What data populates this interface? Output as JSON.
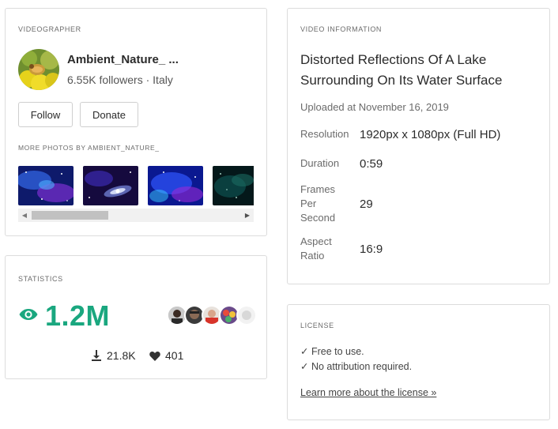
{
  "videographer": {
    "section_label": "VIDEOGRAPHER",
    "name": "Ambient_Nature_ ...",
    "followers": "6.55K followers",
    "separator": " · ",
    "location": "Italy",
    "follow_label": "Follow",
    "donate_label": "Donate",
    "more_photos_label": "MORE PHOTOS BY AMBIENT_NATURE_",
    "thumbnails": [
      "thumb-space-blue-1",
      "thumb-galaxy-spiral",
      "thumb-space-blue-2",
      "thumb-space-teal"
    ]
  },
  "statistics": {
    "section_label": "STATISTICS",
    "views": "1.2M",
    "downloads": "21.8K",
    "likes": "401",
    "accent_color": "#1aa77f"
  },
  "video_info": {
    "section_label": "VIDEO INFORMATION",
    "title": "Distorted Reflections Of A Lake Surrounding On Its Water Surface",
    "uploaded": "Uploaded at November 16, 2019",
    "resolution_key": "Resolution",
    "resolution_value": "1920px x 1080px (Full HD)",
    "duration_key": "Duration",
    "duration_value": "0:59",
    "fps_key": "Frames Per Second",
    "fps_value": "29",
    "aspect_key": "Aspect Ratio",
    "aspect_value": "16:9"
  },
  "license": {
    "section_label": "LICENSE",
    "line1": "✓ Free to use.",
    "line2": "✓ No attribution required.",
    "link": "Learn more about the license »"
  }
}
